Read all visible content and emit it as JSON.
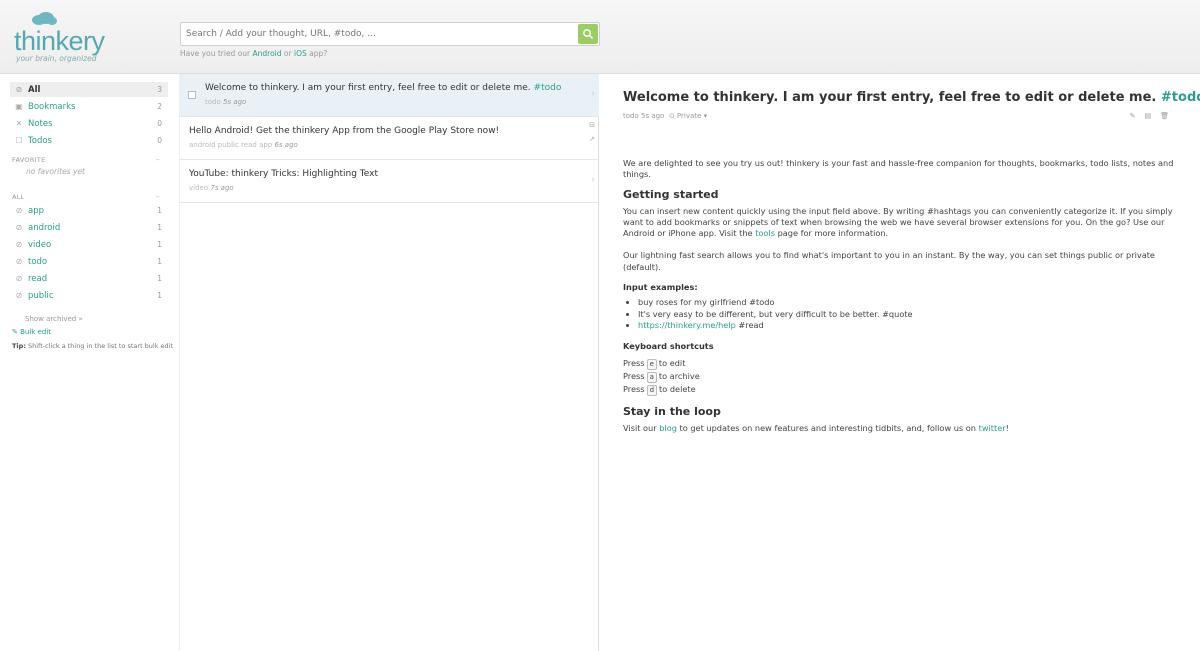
{
  "brand": {
    "name": "thinkery",
    "tagline": "your brain, organized"
  },
  "search": {
    "placeholder": "Search / Add your thought, URL, #todo, ...",
    "hint_prefix": "Have you tried our",
    "hint_android": "Android",
    "hint_or": "or",
    "hint_ios": "iOS",
    "hint_suffix": "app?"
  },
  "sidebar": {
    "nav": [
      {
        "label": "All",
        "count": "3",
        "icon": "tag-icon"
      },
      {
        "label": "Bookmarks",
        "count": "2",
        "icon": "bookmark-icon"
      },
      {
        "label": "Notes",
        "count": "0",
        "icon": "note-icon"
      },
      {
        "label": "Todos",
        "count": "0",
        "icon": "check-icon"
      }
    ],
    "favorite_header": "Favorite",
    "no_favorites": "no favorites yet",
    "all_header": "All",
    "tags": [
      {
        "label": "app",
        "count": "1"
      },
      {
        "label": "android",
        "count": "1"
      },
      {
        "label": "video",
        "count": "1"
      },
      {
        "label": "todo",
        "count": "1"
      },
      {
        "label": "read",
        "count": "1"
      },
      {
        "label": "public",
        "count": "1"
      }
    ],
    "show_archived": "Show archived »",
    "bulk_edit": "Bulk edit",
    "tip_label": "Tip:",
    "tip_text": "Shift-click a thing in the list to start bulk edit"
  },
  "entries": [
    {
      "title": "Welcome to thinkery. I am your first entry, feel free to edit or delete me.",
      "tag": "#todo",
      "meta_tags": "todo",
      "time": "5s ago"
    },
    {
      "title": "Hello Android! Get the thinkery App from the Google Play Store now!",
      "tag": "",
      "meta_tags": "android  public  read  app",
      "time": "6s ago"
    },
    {
      "title": "YouTube: thinkery Tricks: Highlighting Text",
      "tag": "",
      "meta_tags": "video",
      "time": "7s ago"
    }
  ],
  "detail": {
    "title": "Welcome to thinkery. I am your first entry, feel free to edit or delete me.",
    "title_tag": "#todo",
    "meta_tag": "todo",
    "meta_time": "5s ago",
    "privacy": "Private",
    "intro": "We are delighted to see you try us out! thinkery is your fast and hassle-free companion for thoughts, bookmarks, todo lists, notes and things.",
    "h_getting_started": "Getting started",
    "p_getting_started_1": "You can insert new content quickly using the input field above. By writing #hashtags you can conveniently categorize it. If you simply want to add bookmarks or snippets of text when browsing the web we have several browser extensions for you. On the go? Use our Android or iPhone app. Visit the",
    "tools_link": "tools",
    "p_getting_started_2": "page for more information.",
    "p_search": "Our lightning fast search allows you to find what's important to you in an instant. By the way, you can set things public or private (default).",
    "h_input_examples": "Input examples:",
    "examples": [
      "buy roses for my girlfriend #todo",
      "It's very easy to be different, but very difficult to be better. #quote"
    ],
    "example_link": "https://thinkery.me/help",
    "example_link_tag": "#read",
    "h_shortcuts": "Keyboard shortcuts",
    "shortcuts": [
      {
        "pre": "Press",
        "key": "e",
        "post": "to edit"
      },
      {
        "pre": "Press",
        "key": "a",
        "post": "to archive"
      },
      {
        "pre": "Press",
        "key": "d",
        "post": "to delete"
      }
    ],
    "h_loop": "Stay in the loop",
    "loop_1": "Visit our",
    "loop_blog": "blog",
    "loop_2": "to get updates on new features and interesting tidbits, and, follow us on",
    "loop_twitter": "twitter",
    "loop_3": "!"
  },
  "colors": {
    "accent": "#2a9d8f",
    "logo": "#56a8b0",
    "search_button": "#9ccc65",
    "selected_row": "#e9f1f6"
  }
}
